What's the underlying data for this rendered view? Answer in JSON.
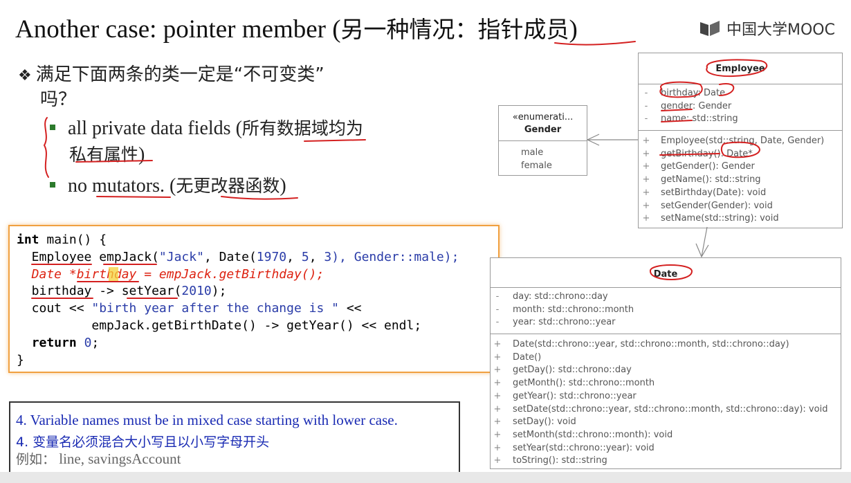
{
  "title": {
    "en": "Another case: pointer member (",
    "zh": "另一种情况：指针成员",
    "close": ")"
  },
  "logo": {
    "text": "中国大学MOOC"
  },
  "bullets": {
    "main_line1": "满足下面两条的类一定是“不可变类”",
    "main_line2": "吗？",
    "sub1_en": "all private data fields (",
    "sub1_zh": "所有数据域均为",
    "sub1_zh2": "私有属性",
    "sub1_close": ")",
    "sub2_en": "no mutators.  (",
    "sub2_zh": "无更改器函数",
    "sub2_close": ")"
  },
  "code": {
    "l1_kw": "int",
    "l1_rest": " main() {",
    "l2_a": "  Employee empJack(",
    "l2_str": "\"Jack\"",
    "l2_b": ", Date(",
    "l2_n1": "1970",
    "l2_c": ", ",
    "l2_n2": "5",
    "l2_d": ", ",
    "l2_n3": "3",
    "l2_e": "), Gender::male);",
    "l3": "  Date *birthday = empJack.getBirthday();",
    "l4_a": "  birthday -> setYear(",
    "l4_n": "2010",
    "l4_b": ");",
    "l5_a": "  cout << ",
    "l5_str": "\"birth year after the change is \"",
    "l5_b": " <<",
    "l6": "          empJack.getBirthDate() -> getYear() << endl;",
    "l7_kw": "return",
    "l7_n": "0",
    "l7_end": ";",
    "l8": "}"
  },
  "note": {
    "line1": "4. Variable names must be in mixed case starting with lower case.",
    "line2": "4. 变量名必须混合大小写且以小写字母开头",
    "line3_zh": "例如：",
    "line3_en": " line, savingsAccount"
  },
  "employee": {
    "name": "Employee",
    "attributes": [
      {
        "vis": "-",
        "text": "birthday: Date"
      },
      {
        "vis": "-",
        "text": "gender: Gender"
      },
      {
        "vis": "-",
        "text": "name: std::string"
      }
    ],
    "operations": [
      {
        "vis": "+",
        "text": "Employee(std::string, Date, Gender)"
      },
      {
        "vis": "+",
        "text": "getBirthday(): Date*"
      },
      {
        "vis": "+",
        "text": "getGender(): Gender"
      },
      {
        "vis": "+",
        "text": "getName(): std::string"
      },
      {
        "vis": "+",
        "text": "setBirthday(Date): void"
      },
      {
        "vis": "+",
        "text": "setGender(Gender): void"
      },
      {
        "vis": "+",
        "text": "setName(std::string): void"
      }
    ]
  },
  "gender": {
    "stereotype": "«enumerati...",
    "name": "Gender",
    "values": [
      "male",
      "female"
    ]
  },
  "date": {
    "name": "Date",
    "attributes": [
      {
        "vis": "-",
        "text": "day: std::chrono::day"
      },
      {
        "vis": "-",
        "text": "month: std::chrono::month"
      },
      {
        "vis": "-",
        "text": "year: std::chrono::year"
      }
    ],
    "operations": [
      {
        "vis": "+",
        "text": "Date(std::chrono::year, std::chrono::month, std::chrono::day)"
      },
      {
        "vis": "+",
        "text": "Date()"
      },
      {
        "vis": "+",
        "text": "getDay(): std::chrono::day"
      },
      {
        "vis": "+",
        "text": "getMonth(): std::chrono::month"
      },
      {
        "vis": "+",
        "text": "getYear(): std::chrono::year"
      },
      {
        "vis": "+",
        "text": "setDate(std::chrono::year, std::chrono::month, std::chrono::day): void"
      },
      {
        "vis": "+",
        "text": "setDay(): void"
      },
      {
        "vis": "+",
        "text": "setMonth(std::chrono::month): void"
      },
      {
        "vis": "+",
        "text": "setYear(std::chrono::year): void"
      },
      {
        "vis": "+",
        "text": "toString(): std::string"
      }
    ]
  },
  "colors": {
    "annotation": "#d42020",
    "code_border": "#f0a040",
    "note_text": "#1a2bb3",
    "bullet_square": "#2c7a2c"
  }
}
